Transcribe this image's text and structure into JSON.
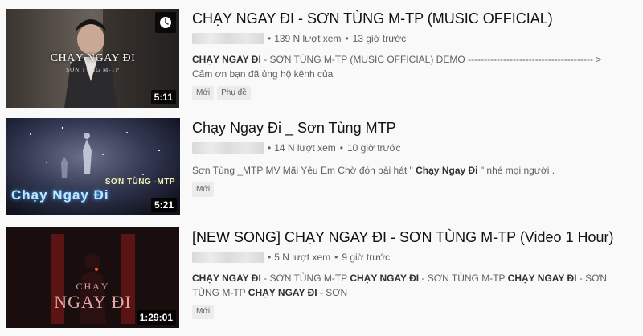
{
  "videos": [
    {
      "title": "CHẠY NGAY ĐI - SƠN TÙNG M-TP (MUSIC OFFICIAL)",
      "views": "139 N lượt xem",
      "age": "13 giờ trước",
      "description": [
        {
          "text": "CHẠY NGAY ĐI",
          "bold": true
        },
        {
          "text": " - SƠN TÙNG M-TP (MUSIC OFFICIAL) DEMO --------------------------------------- > Cảm ơn bạn đã ủng hộ kênh của",
          "bold": false
        }
      ],
      "badges": [
        "Mới",
        "Phụ đề"
      ],
      "duration": "5:11",
      "thumb_title": "CHẠY NGAY ĐI",
      "thumb_subtitle": "SƠN TÙNG M-TP"
    },
    {
      "title": "Chạy Ngay Đi _ Sơn Tùng MTP",
      "views": "14 N lượt xem",
      "age": "10 giờ trước",
      "description": [
        {
          "text": "Sơn Tùng _MTP MV Mãi Yêu Em Chờ đón bài hát \" ",
          "bold": false
        },
        {
          "text": "Chạy Ngay Đi",
          "bold": true
        },
        {
          "text": " \" nhé mọi người .",
          "bold": false
        }
      ],
      "badges": [
        "Mới"
      ],
      "duration": "5:21",
      "thumb_title": "Chạy Ngay Đi",
      "thumb_subtitle": "SƠN TÙNG -MTP"
    },
    {
      "title": "[NEW SONG] CHẠY NGAY ĐI - SƠN TÙNG M-TP (Video 1 Hour)",
      "views": "5 N lượt xem",
      "age": "9 giờ trước",
      "description": [
        {
          "text": "CHẠY NGAY ĐI",
          "bold": true
        },
        {
          "text": " - SƠN TÙNG M-TP ",
          "bold": false
        },
        {
          "text": "CHẠY NGAY ĐI",
          "bold": true
        },
        {
          "text": " - SƠN TÙNG M-TP ",
          "bold": false
        },
        {
          "text": "CHẠY NGAY ĐI",
          "bold": true
        },
        {
          "text": " - SƠN TÙNG M-TP ",
          "bold": false
        },
        {
          "text": "CHẠY NGAY ĐI",
          "bold": true
        },
        {
          "text": " - SƠN",
          "bold": false
        }
      ],
      "badges": [
        "Mới"
      ],
      "duration": "1:29:01",
      "thumb_title_top": "CHẠY",
      "thumb_title_bottom": "NGAY ĐI"
    }
  ],
  "separator": "•",
  "icons": {
    "watch_later": "clock-icon"
  }
}
